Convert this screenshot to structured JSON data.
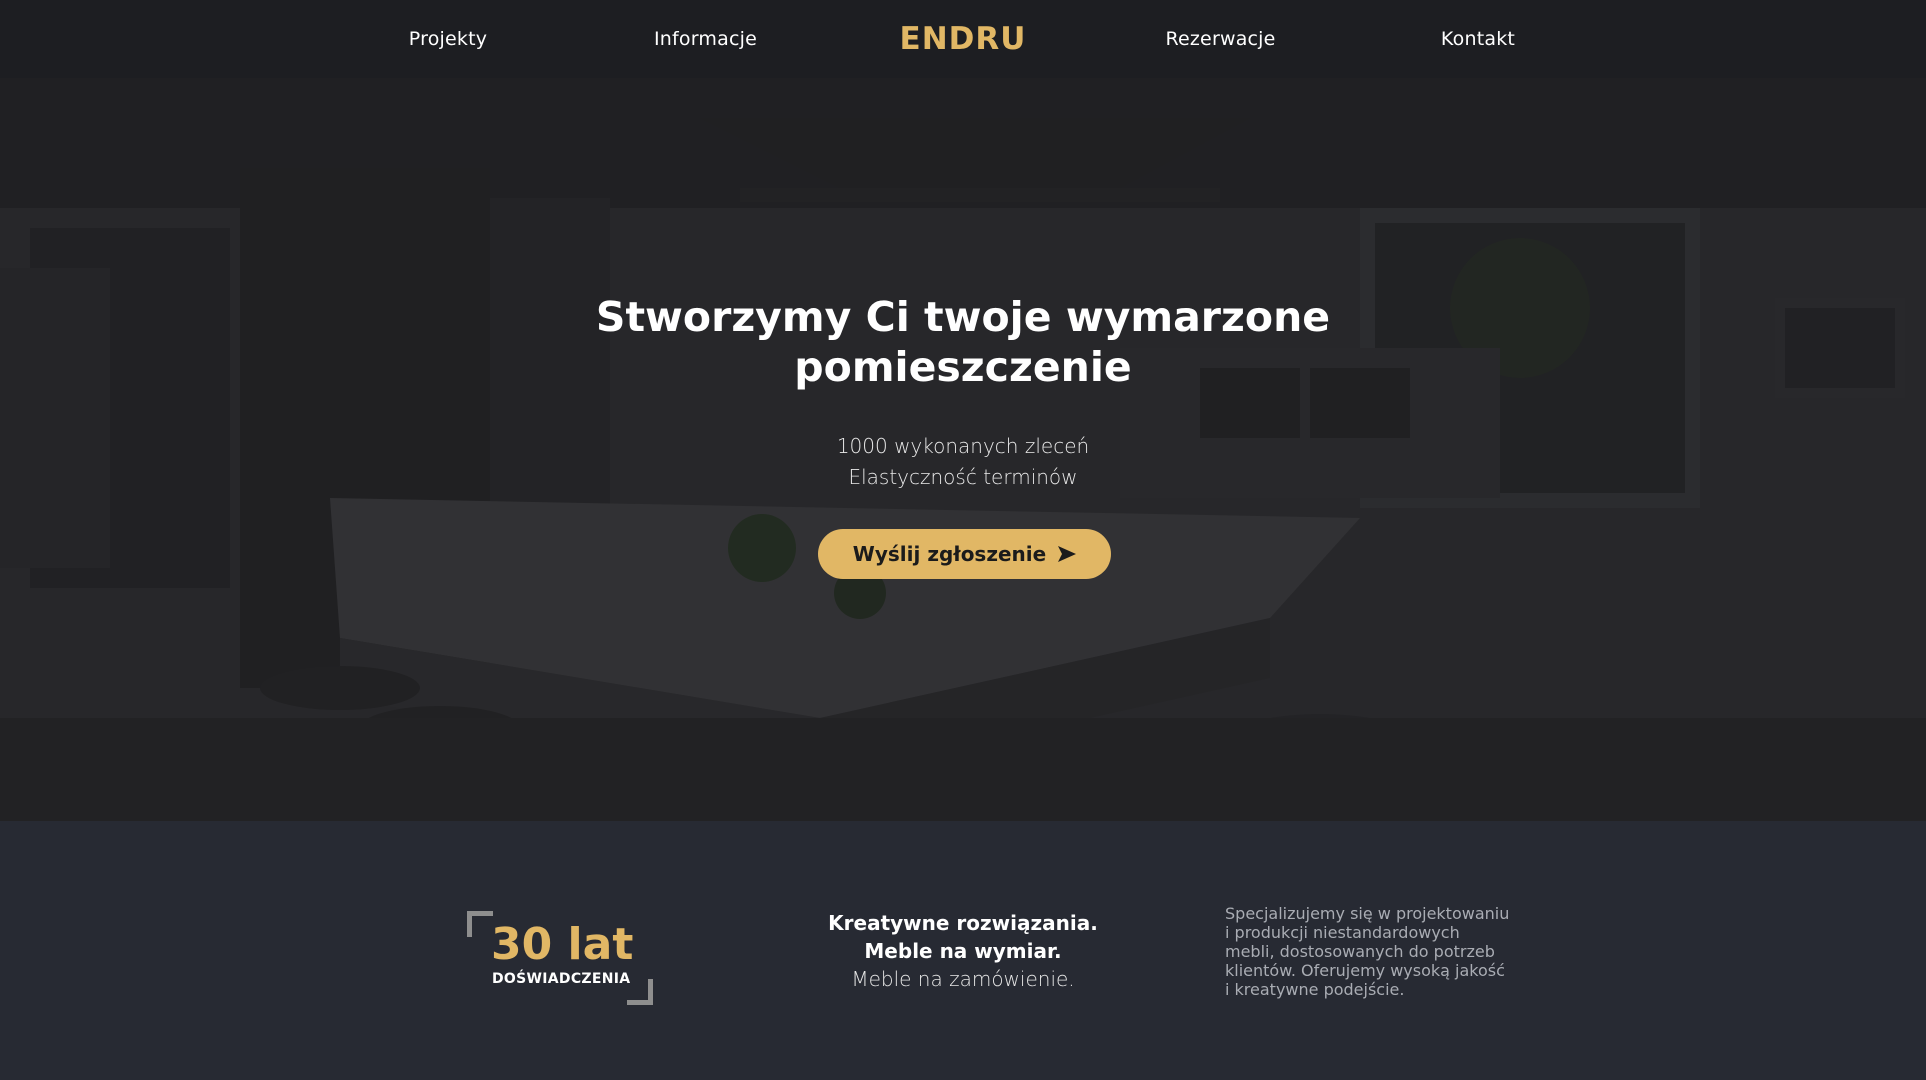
{
  "nav": {
    "items_left": [
      "Projekty",
      "Informacje"
    ],
    "brand": "ENDRU",
    "items_right": [
      "Rezerwacje",
      "Kontakt"
    ]
  },
  "hero": {
    "title_line1": "Stworzymy Ci twoje wymarzone",
    "title_line2": "pomieszczenie",
    "sub_line1": "1000 wykonanych zleceń",
    "sub_line2": "Elastyczność terminów",
    "cta_label": "Wyślij zgłoszenie",
    "cta_icon": "arrow-right-icon"
  },
  "experience": {
    "number": "30 lat",
    "label": "DOŚWIADCZENIA"
  },
  "features": {
    "line1": "Kreatywne rozwiązania.",
    "line2": "Meble na wymiar.",
    "line3": "Meble na zamówienie."
  },
  "description": {
    "lines": [
      "Specjalizujemy się w projektowaniu",
      "i produkcji niestandardowych",
      "mebli, dostosowanych do potrzeb",
      "klientów. Oferujemy wysoką jakość",
      "i kreatywne podejście."
    ]
  },
  "colors": {
    "accent": "#e1b765",
    "nav_bg": "#1d1e22",
    "bottom_bg": "#272a33"
  }
}
